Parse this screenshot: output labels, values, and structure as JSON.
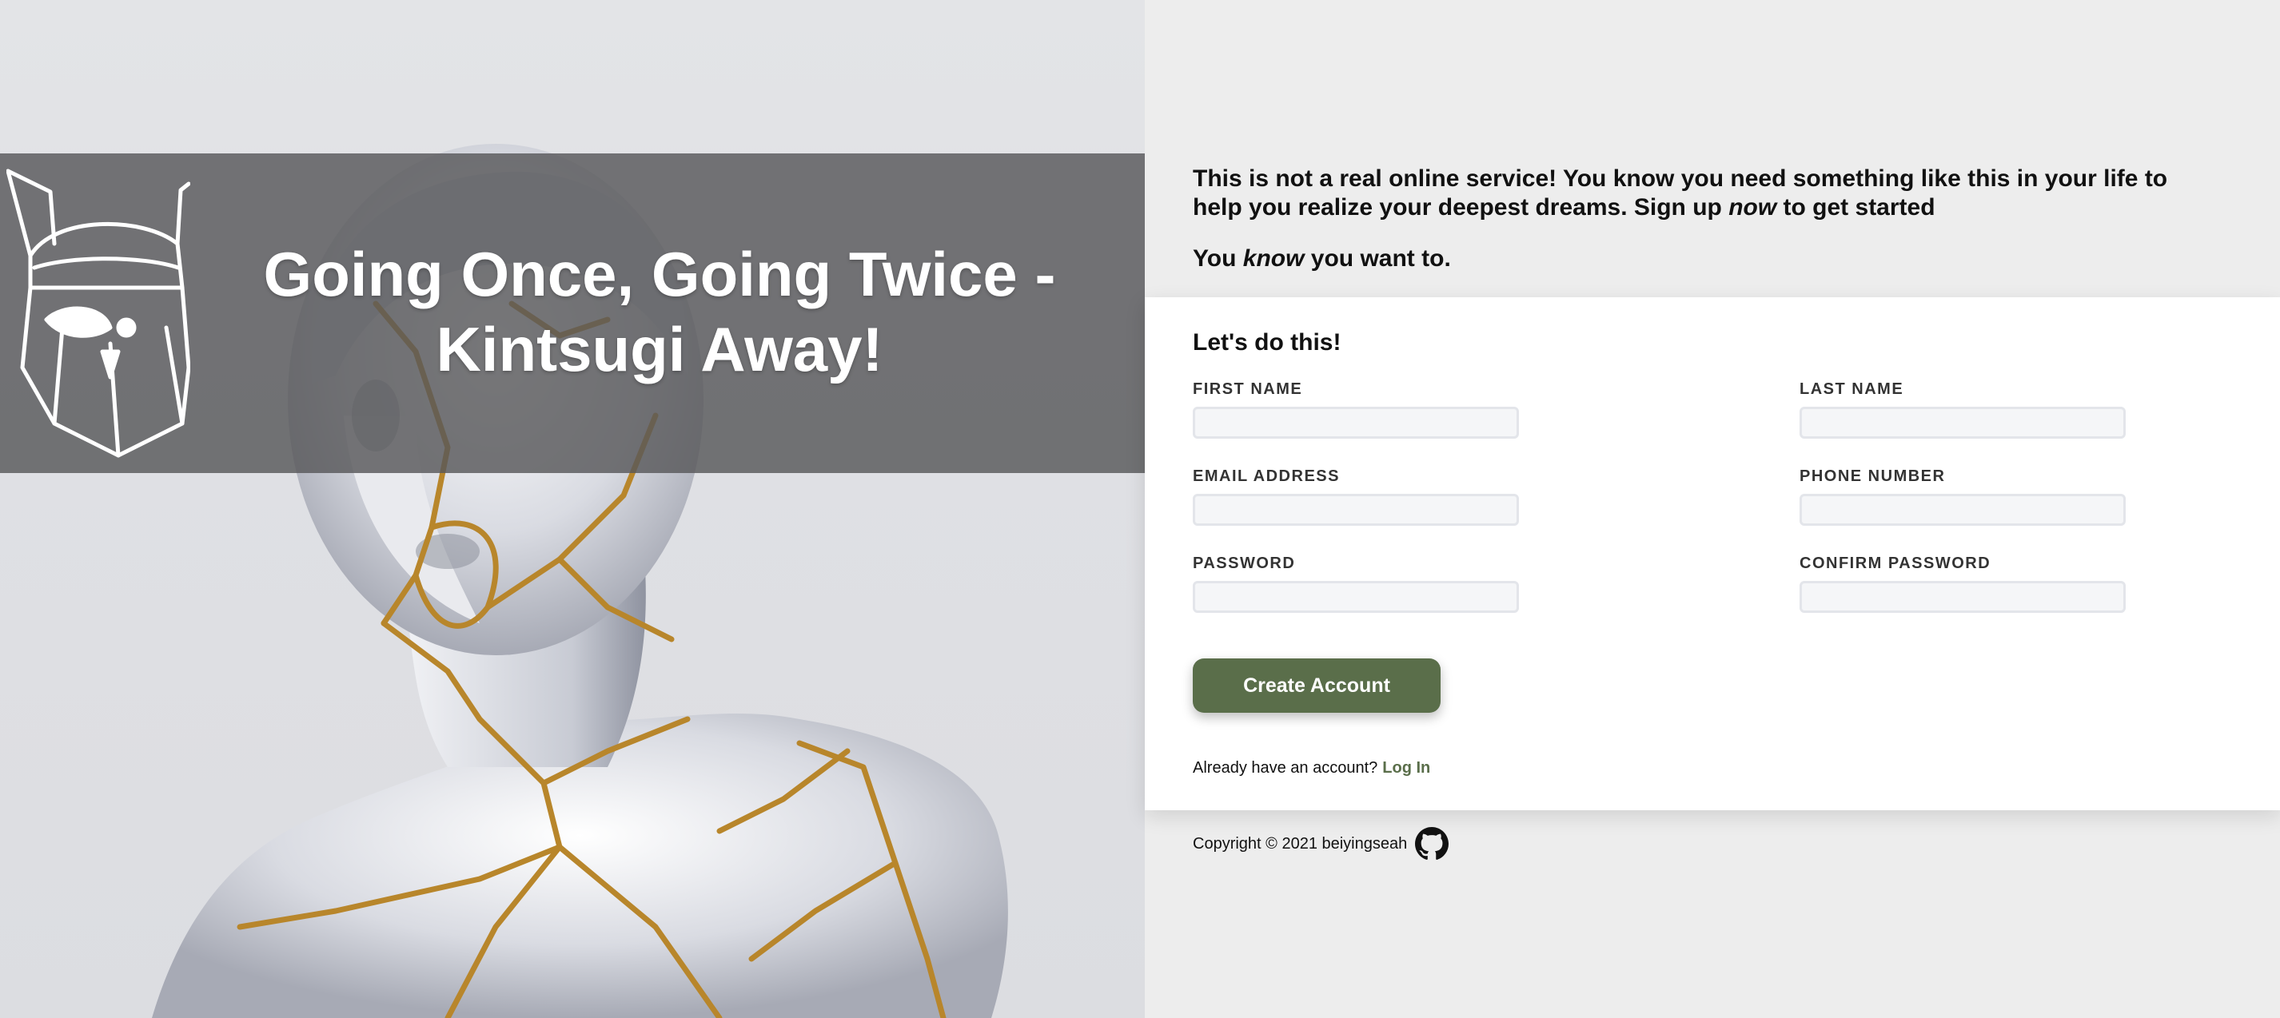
{
  "hero": {
    "title_line1": "Going Once, Going Twice -",
    "title_line2": "Kintsugi Away!",
    "logo_icon": "bearded-viking-helmet-icon",
    "background": "cracked-statue-with-gold-kintsugi-seams"
  },
  "intro": {
    "line1": "This is not a real online service! You know you need something like this in your life to help you realize your deepest dreams. Sign up ",
    "line1_emphasis": "now",
    "line1_end": " to get started",
    "line2_start": "You ",
    "line2_emphasis": "know",
    "line2_end": " you want to."
  },
  "form": {
    "heading": "Let's do this!",
    "fields": {
      "first_name": {
        "label": "FIRST NAME",
        "value": ""
      },
      "last_name": {
        "label": "LAST NAME",
        "value": ""
      },
      "email": {
        "label": "EMAIL ADDRESS",
        "value": ""
      },
      "phone": {
        "label": "PHONE NUMBER",
        "value": ""
      },
      "password": {
        "label": "PASSWORD",
        "value": ""
      },
      "confirm_password": {
        "label": "CONFIRM PASSWORD",
        "value": ""
      }
    },
    "submit_label": "Create Account",
    "login_prompt": "Already have an account?",
    "login_link": "Log In"
  },
  "footer": {
    "copyright": "Copyright © 2021 beiyingseah",
    "github_icon": "github-icon"
  },
  "colors": {
    "accent": "#5a6e4a",
    "panel_bg": "#ededed",
    "hero_band": "#58585a",
    "gold": "#b8862b"
  }
}
